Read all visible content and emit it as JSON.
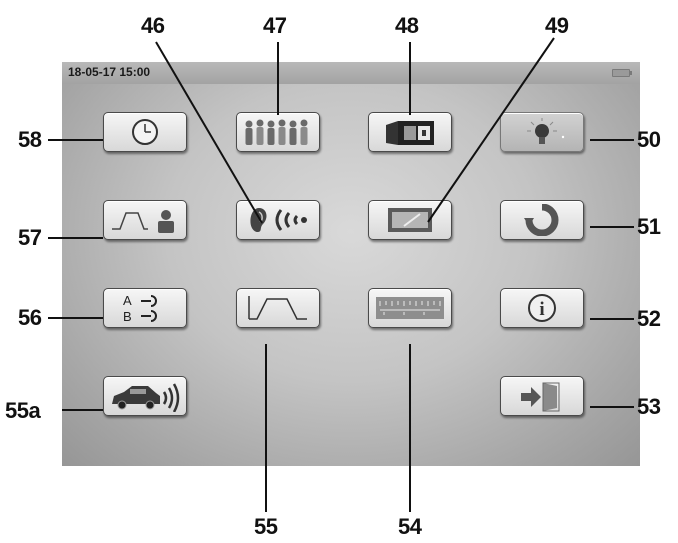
{
  "status": {
    "datetime": "18-05-17 15:00"
  },
  "callouts": {
    "c46": "46",
    "c47": "47",
    "c48": "48",
    "c49": "49",
    "c50": "50",
    "c51": "51",
    "c52": "52",
    "c53": "53",
    "c54": "54",
    "c55": "55",
    "c55a": "55a",
    "c56": "56",
    "c57": "57",
    "c58": "58"
  },
  "icons": {
    "clock": "clock-icon",
    "people": "people-icon",
    "switch": "switch-icon",
    "light": "lightbulb-icon",
    "trapezoid_worker": "trapezoid-worker-icon",
    "ear_wave": "ear-sound-icon",
    "tablet": "tablet-icon",
    "refresh": "refresh-icon",
    "ab_input": "ab-input-icon",
    "trapezoid": "trapezoid-icon",
    "ruler": "ruler-icon",
    "info": "info-icon",
    "car_signal": "car-signal-icon",
    "exit": "exit-icon"
  },
  "ab_labels": {
    "a": "A",
    "b": "B"
  },
  "info_glyph": "i"
}
